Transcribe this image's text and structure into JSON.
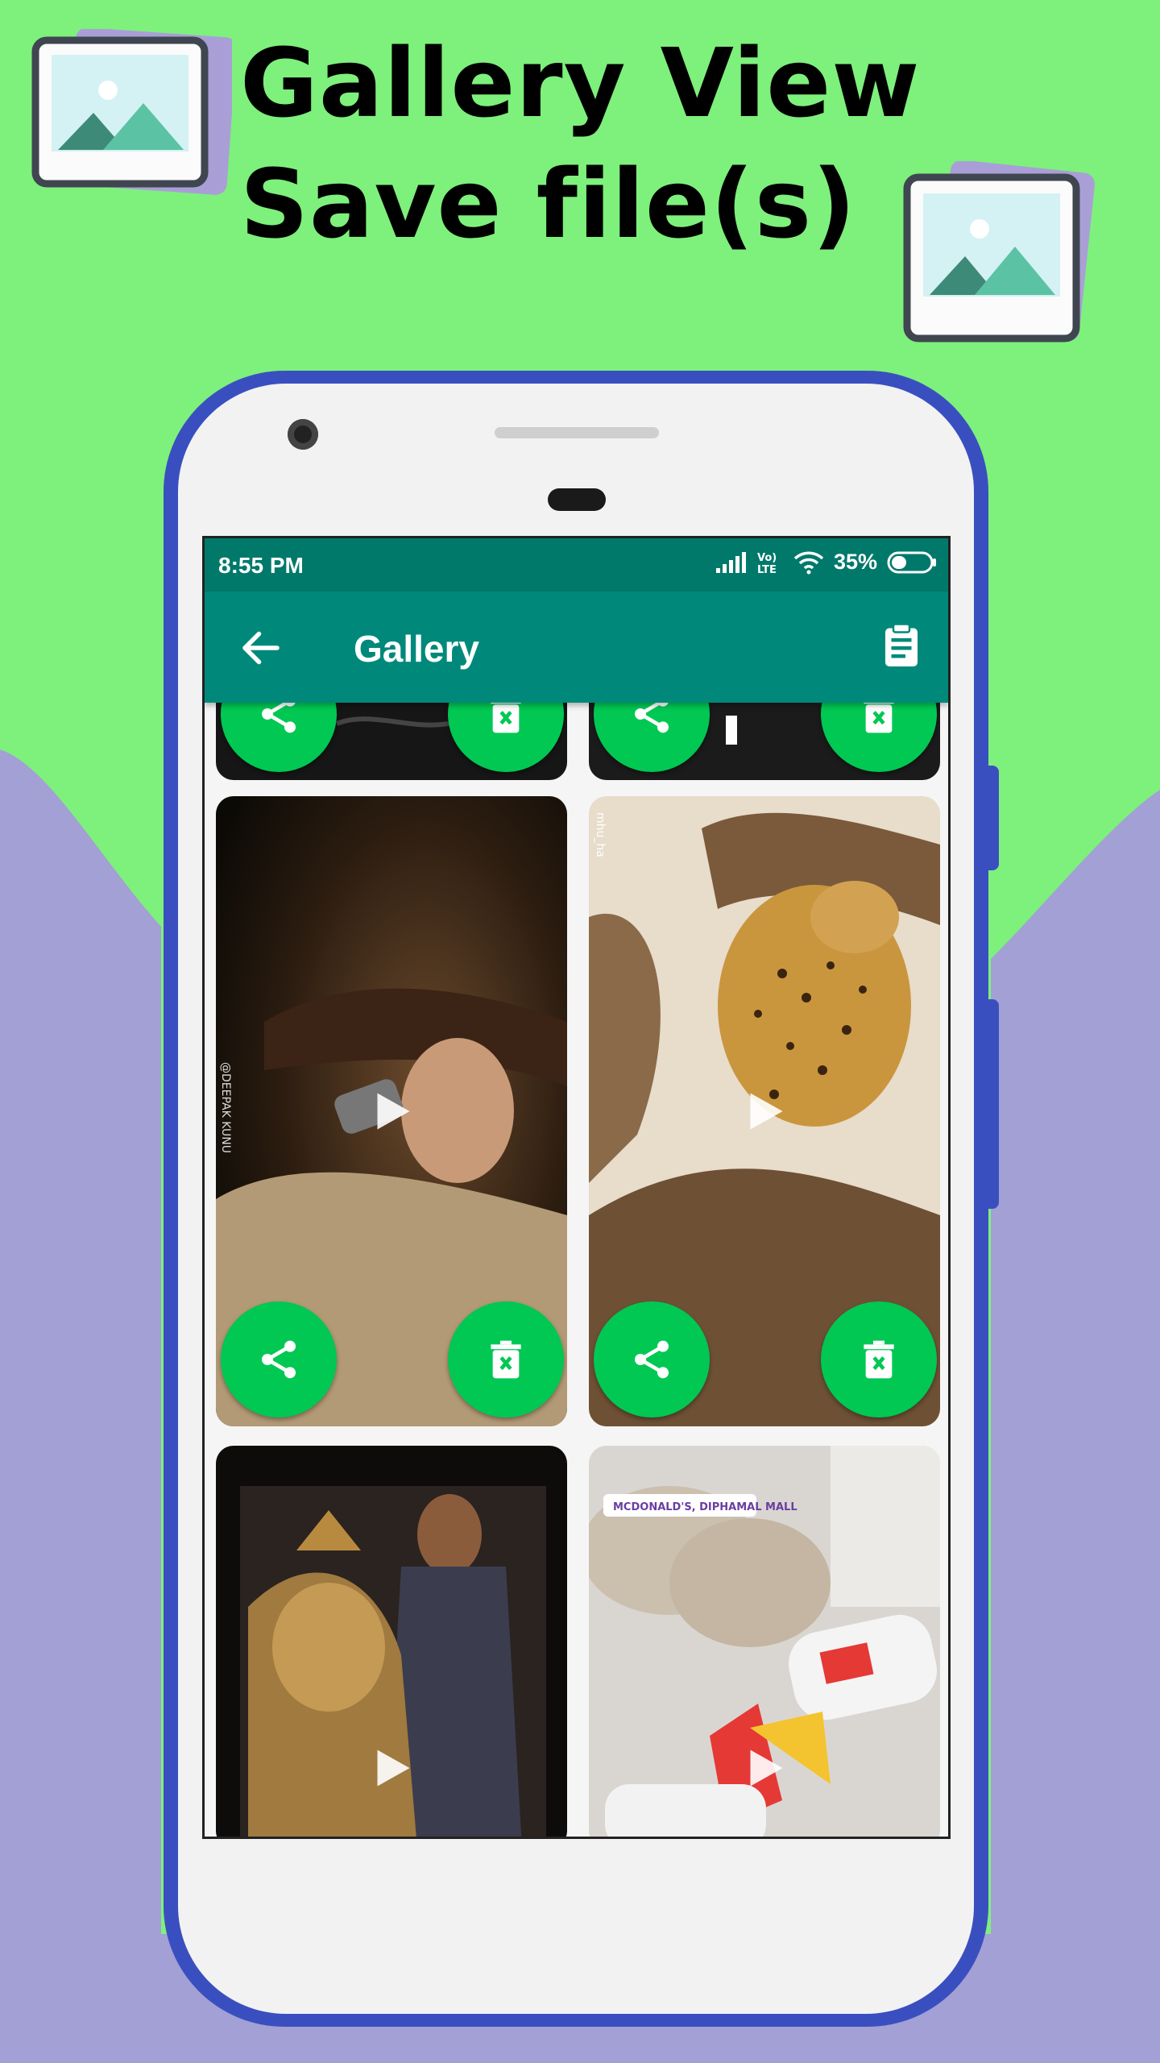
{
  "promo": {
    "title_line1": "Gallery View",
    "title_line2": "Save file(s)"
  },
  "status_bar": {
    "time": "8:55 PM",
    "network": "Vo) LTE",
    "battery": "35%"
  },
  "app_bar": {
    "title": "Gallery",
    "back_icon": "arrow-back-icon",
    "action_icon": "clipboard-icon"
  },
  "gallery": {
    "items": [
      {
        "kind": "video",
        "description": "partial-top-left",
        "share_icon": "share-icon",
        "delete_icon": "delete-icon"
      },
      {
        "kind": "video",
        "description": "partial-top-right",
        "share_icon": "share-icon",
        "delete_icon": "delete-icon"
      },
      {
        "kind": "video",
        "description": "woman-singing-microphone",
        "watermark": "@DEEPAK KUNU",
        "share_icon": "share-icon",
        "delete_icon": "delete-icon"
      },
      {
        "kind": "video",
        "description": "leopard-on-tree",
        "watermark": "mhu_ha",
        "share_icon": "share-icon",
        "delete_icon": "delete-icon"
      },
      {
        "kind": "video",
        "description": "man-with-ganesha-statue",
        "share_icon": "share-icon",
        "delete_icon": "delete-icon"
      },
      {
        "kind": "video",
        "description": "fast-food-meal",
        "sticker": "MCDONALD'S, DIPHAMAL MALL",
        "share_icon": "share-icon",
        "delete_icon": "delete-icon"
      }
    ]
  },
  "colors": {
    "background_green": "#7ef07c",
    "background_purple": "#a2a0d4",
    "phone_frame": "#3a4fbf",
    "status_bar": "#00796b",
    "app_bar": "#00897b",
    "fab": "#00c853"
  }
}
